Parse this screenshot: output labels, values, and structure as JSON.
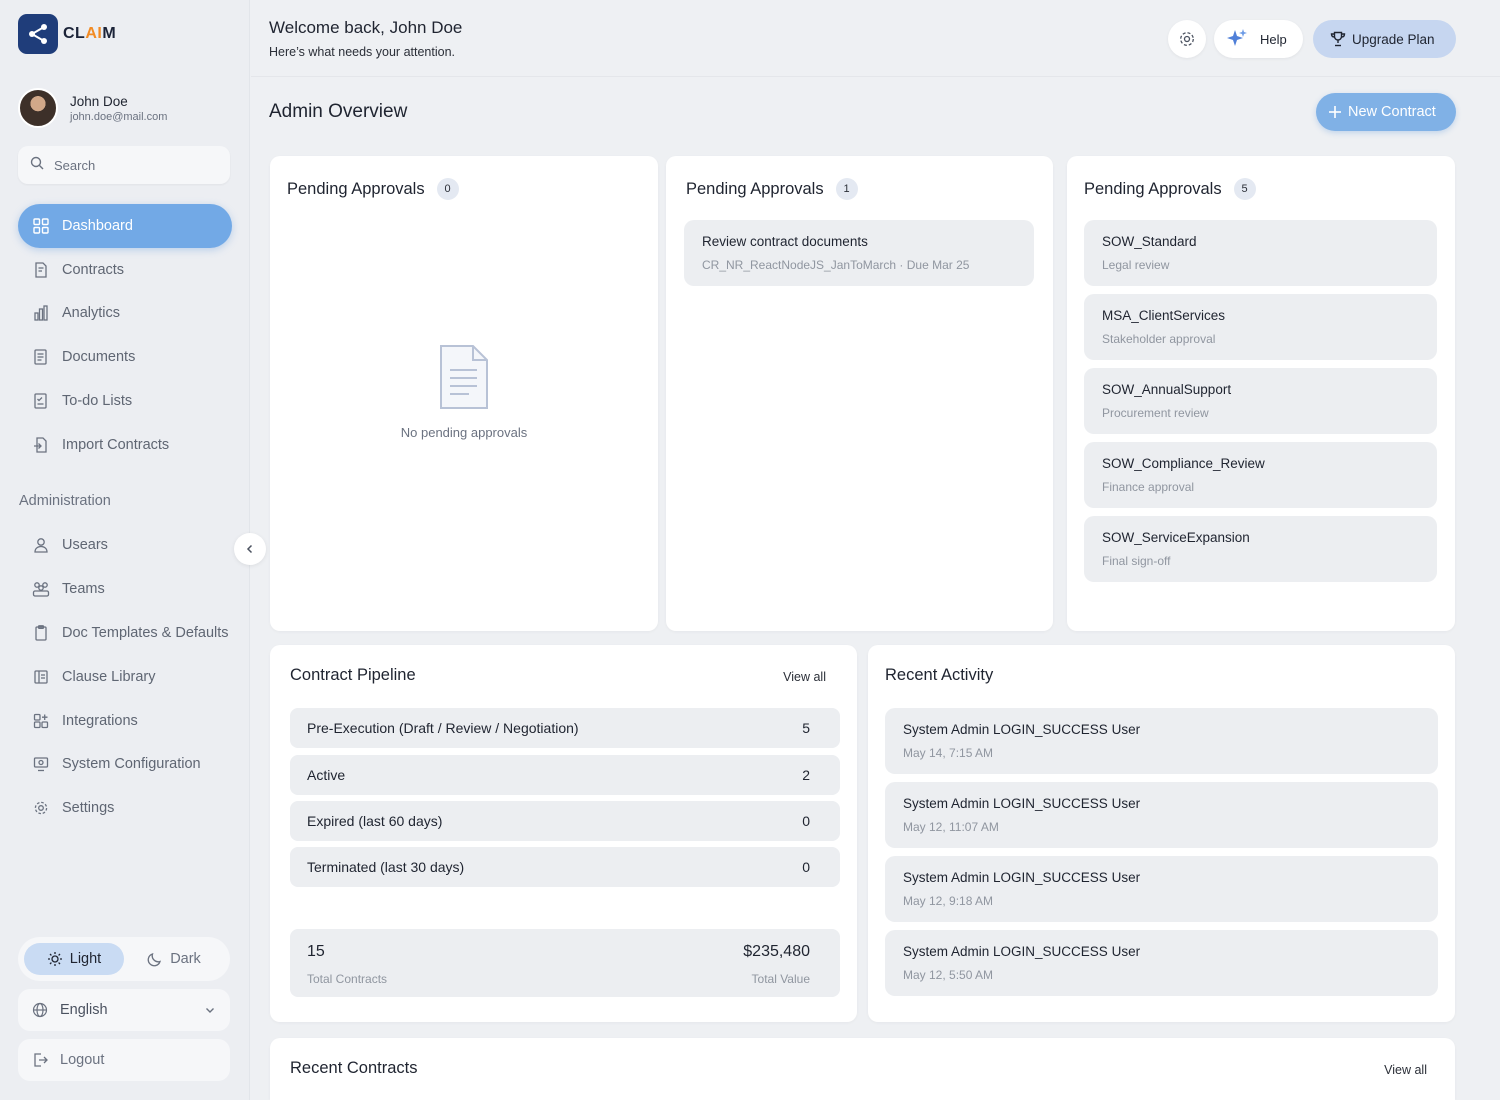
{
  "brand": {
    "name_prefix": "CL",
    "name_highlight": "AI",
    "name_suffix": "M"
  },
  "user": {
    "name": "John Doe",
    "email": "john.doe@mail.com"
  },
  "search": {
    "placeholder": "Search"
  },
  "nav": {
    "main": [
      {
        "label": "Dashboard",
        "icon": "grid-icon",
        "active": true
      },
      {
        "label": "Contracts",
        "icon": "document-edit-icon"
      },
      {
        "label": "Analytics",
        "icon": "bar-chart-icon"
      },
      {
        "label": "Documents",
        "icon": "documents-icon"
      },
      {
        "label": "To-do Lists",
        "icon": "checklist-icon"
      },
      {
        "label": "Import Contracts",
        "icon": "import-icon"
      }
    ],
    "admin_label": "Administration",
    "admin": [
      {
        "label": "Usears",
        "icon": "user-icon"
      },
      {
        "label": "Teams",
        "icon": "team-icon"
      },
      {
        "label": "Doc Templates & Defaults",
        "icon": "template-icon"
      },
      {
        "label": "Clause Library",
        "icon": "library-icon"
      },
      {
        "label": "Integrations",
        "icon": "integrations-icon"
      },
      {
        "label": "System Configuration",
        "icon": "system-config-icon"
      },
      {
        "label": "Settings",
        "icon": "gear-icon"
      }
    ]
  },
  "theme": {
    "light": "Light",
    "dark": "Dark",
    "selected": "Light"
  },
  "language": {
    "selected": "English"
  },
  "logout_label": "Logout",
  "header": {
    "welcome": "Welcome back, John Doe",
    "subtitle": "Here’s what needs your attention.",
    "help": "Help",
    "upgrade": "Upgrade Plan"
  },
  "page": {
    "title": "Admin Overview",
    "new_contract": "New Contract"
  },
  "approvals": [
    {
      "title": "Pending Approvals",
      "count": "0",
      "empty_text": "No pending approvals",
      "items": []
    },
    {
      "title": "Pending Approvals",
      "count": "1",
      "items": [
        {
          "title": "Review contract documents",
          "sub": "CR_NR_ReactNodeJS_JanToMarch · Due Mar 25"
        }
      ]
    },
    {
      "title": "Pending Approvals",
      "count": "5",
      "items": [
        {
          "title": "SOW_Standard",
          "sub": "Legal review"
        },
        {
          "title": "MSA_ClientServices",
          "sub": "Stakeholder approval"
        },
        {
          "title": "SOW_AnnualSupport",
          "sub": "Procurement review"
        },
        {
          "title": "SOW_Compliance_Review",
          "sub": "Finance approval"
        },
        {
          "title": "SOW_ServiceExpansion",
          "sub": "Final sign-off"
        }
      ]
    }
  ],
  "pipeline": {
    "title": "Contract Pipeline",
    "view_all": "View all",
    "rows": [
      {
        "label": "Pre-Execution (Draft / Review / Negotiation)",
        "value": "5"
      },
      {
        "label": "Active",
        "value": "2"
      },
      {
        "label": "Expired (last 60 days)",
        "value": "0"
      },
      {
        "label": "Terminated (last 30 days)",
        "value": "0"
      }
    ],
    "total_contracts": "15",
    "total_contracts_label": "Total Contracts",
    "total_value": "$235,480",
    "total_value_label": "Total Value"
  },
  "activity": {
    "title": "Recent Activity",
    "items": [
      {
        "title": "System Admin LOGIN_SUCCESS User",
        "time": "May 14, 7:15 AM"
      },
      {
        "title": "System Admin LOGIN_SUCCESS User",
        "time": "May 12, 11:07 AM"
      },
      {
        "title": "System Admin LOGIN_SUCCESS User",
        "time": "May 12, 9:18 AM"
      },
      {
        "title": "System Admin LOGIN_SUCCESS User",
        "time": "May 12, 5:50 AM"
      }
    ]
  },
  "recent_contracts": {
    "title": "Recent Contracts",
    "view_all": "View all"
  },
  "colors": {
    "accent": "#72a9e6",
    "brand": "#1f3d7a",
    "upgrade": "#c6d6f0",
    "card_item": "#eceef1"
  }
}
